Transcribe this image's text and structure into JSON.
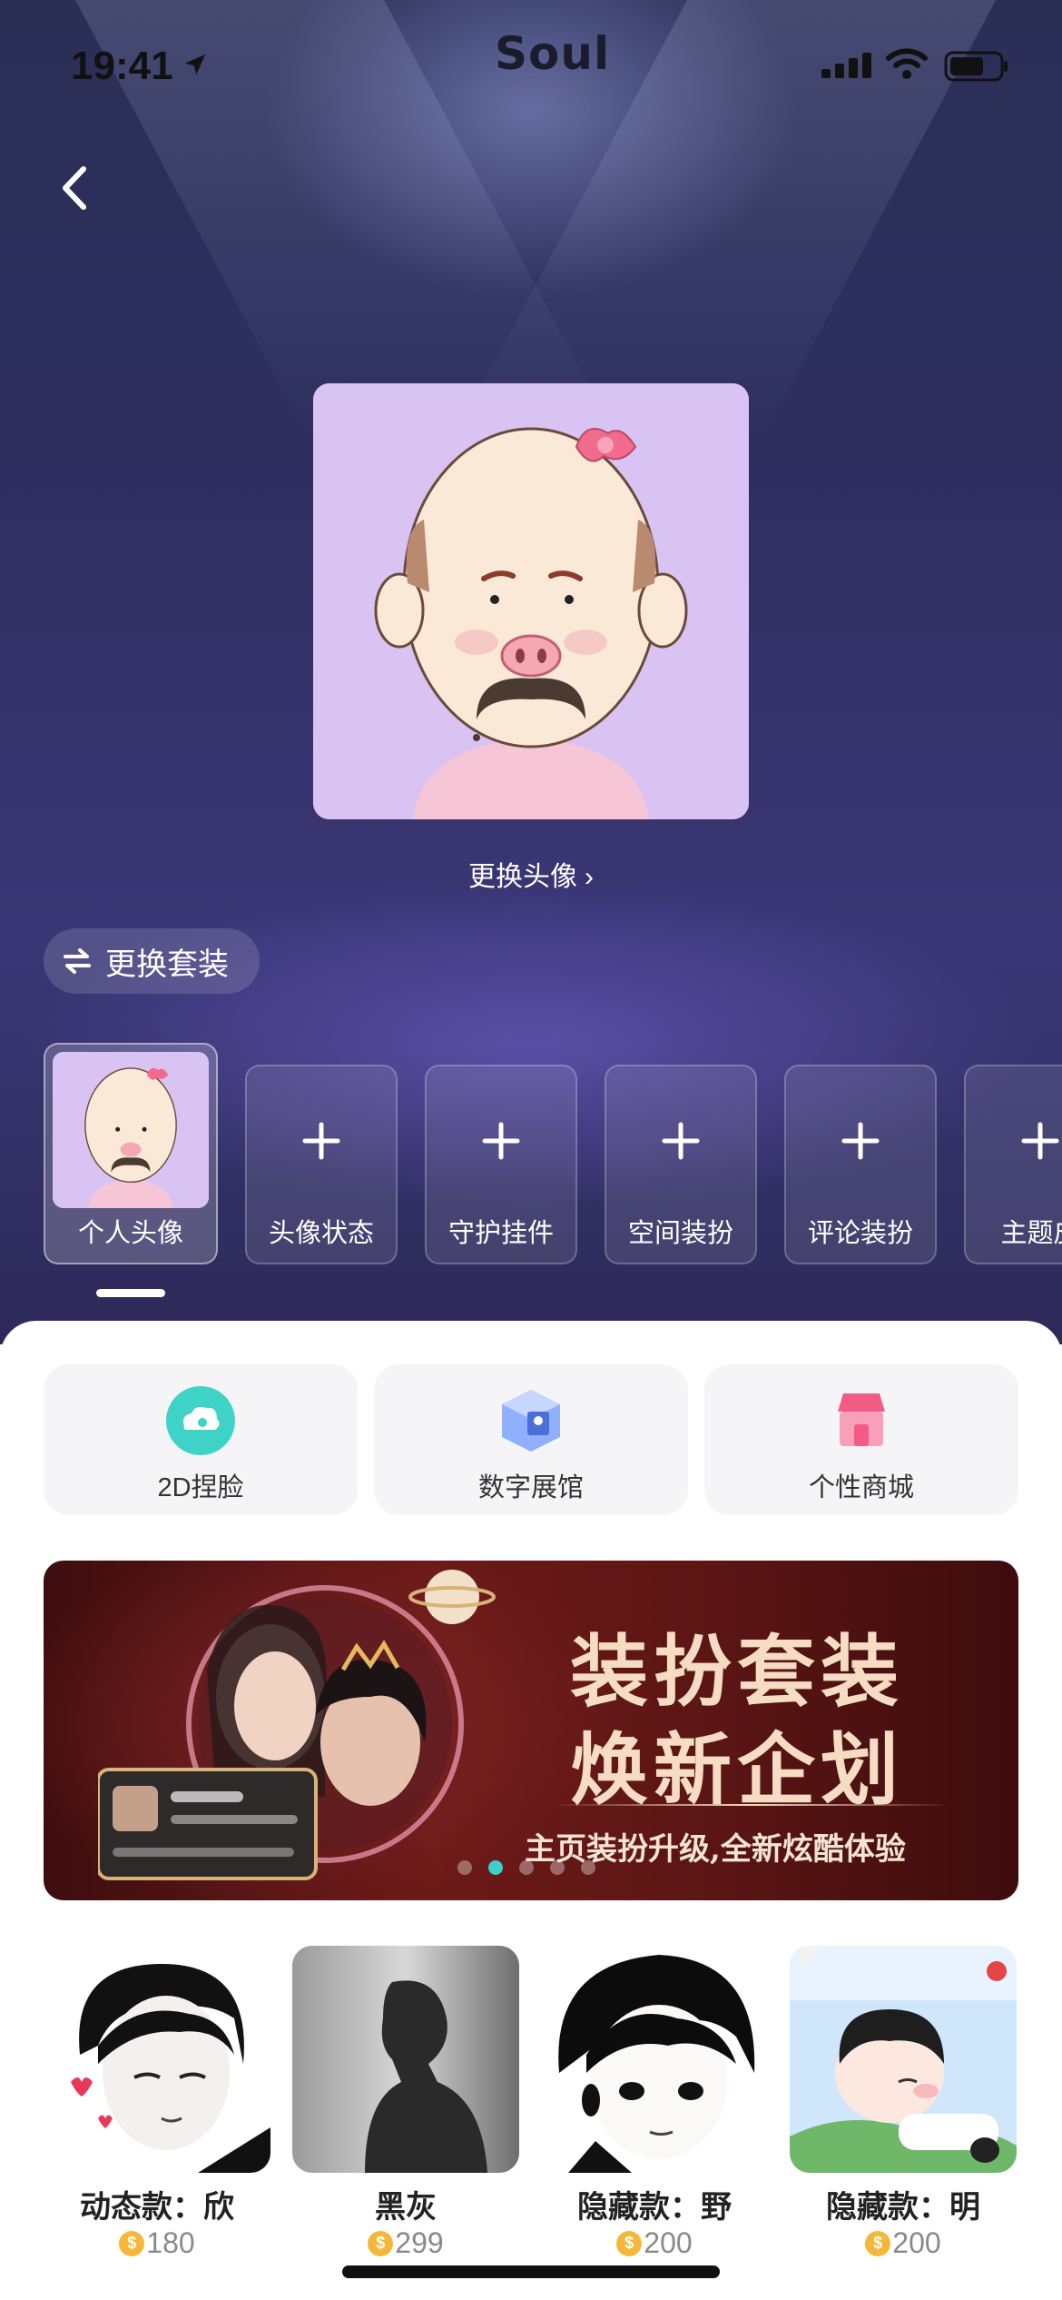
{
  "status_bar": {
    "time": "19:41",
    "app_name": "Soul"
  },
  "avatar": {
    "change_label": "更换头像"
  },
  "suit": {
    "change_label": "更换套装"
  },
  "slots": [
    {
      "label": "个人头像",
      "active": true
    },
    {
      "label": "头像状态"
    },
    {
      "label": "守护挂件"
    },
    {
      "label": "空间装扮"
    },
    {
      "label": "评论装扮"
    },
    {
      "label": "主题皮"
    }
  ],
  "quick_actions": [
    {
      "label": "2D捏脸",
      "icon": "face-cloud-icon",
      "color": "#3fd2c7"
    },
    {
      "label": "数字展馆",
      "icon": "gallery-box-icon",
      "color": "#6b8cf2"
    },
    {
      "label": "个性商城",
      "icon": "shop-icon",
      "color": "#f25b85"
    }
  ],
  "banner": {
    "title_line1": "装扮套装",
    "title_line2": "焕新企划",
    "subtitle": "主页装扮升级,全新炫酷体验",
    "page_count": 5,
    "active_index": 1
  },
  "products": [
    {
      "name": "动态款：欣",
      "price": "180"
    },
    {
      "name": "黑灰",
      "price": "299"
    },
    {
      "name": "隐藏款：野",
      "price": "200"
    },
    {
      "name": "隐藏款：明",
      "price": "200"
    }
  ],
  "colors": {
    "accent_teal": "#39d1c8",
    "coin": "#f5b73a",
    "top_bg": "#2e2f5f"
  }
}
